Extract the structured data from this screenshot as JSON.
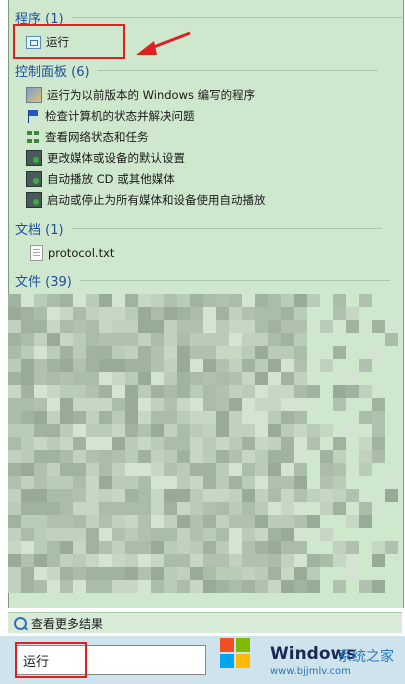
{
  "categories": {
    "programs": "程序 (1)",
    "control_panel": "控制面板 (6)",
    "documents": "文档 (1)",
    "files": "文件 (39)"
  },
  "programs": [
    "运行"
  ],
  "control_panel_items": [
    {
      "label": "运行为以前版本的 Windows 编写的程序",
      "icon": "compat-icon"
    },
    {
      "label": "检查计算机的状态并解决问题",
      "icon": "flag-icon"
    },
    {
      "label": "查看网络状态和任务",
      "icon": "network-icon"
    },
    {
      "label": "更改媒体或设备的默认设置",
      "icon": "autoplay-icon"
    },
    {
      "label": "自动播放 CD 或其他媒体",
      "icon": "autoplay-icon"
    },
    {
      "label": "启动或停止为所有媒体和设备使用自动播放",
      "icon": "autoplay-icon"
    }
  ],
  "documents": [
    "protocol.txt"
  ],
  "see_more": "查看更多结果",
  "search_value": "运行",
  "watermark": {
    "brand": "Windows",
    "cn": "系统之家",
    "url": "www.bjjmlv.com"
  },
  "colors": {
    "highlight": "#e02020",
    "panel": "#cfe8cd",
    "category": "#1c4f9c"
  }
}
